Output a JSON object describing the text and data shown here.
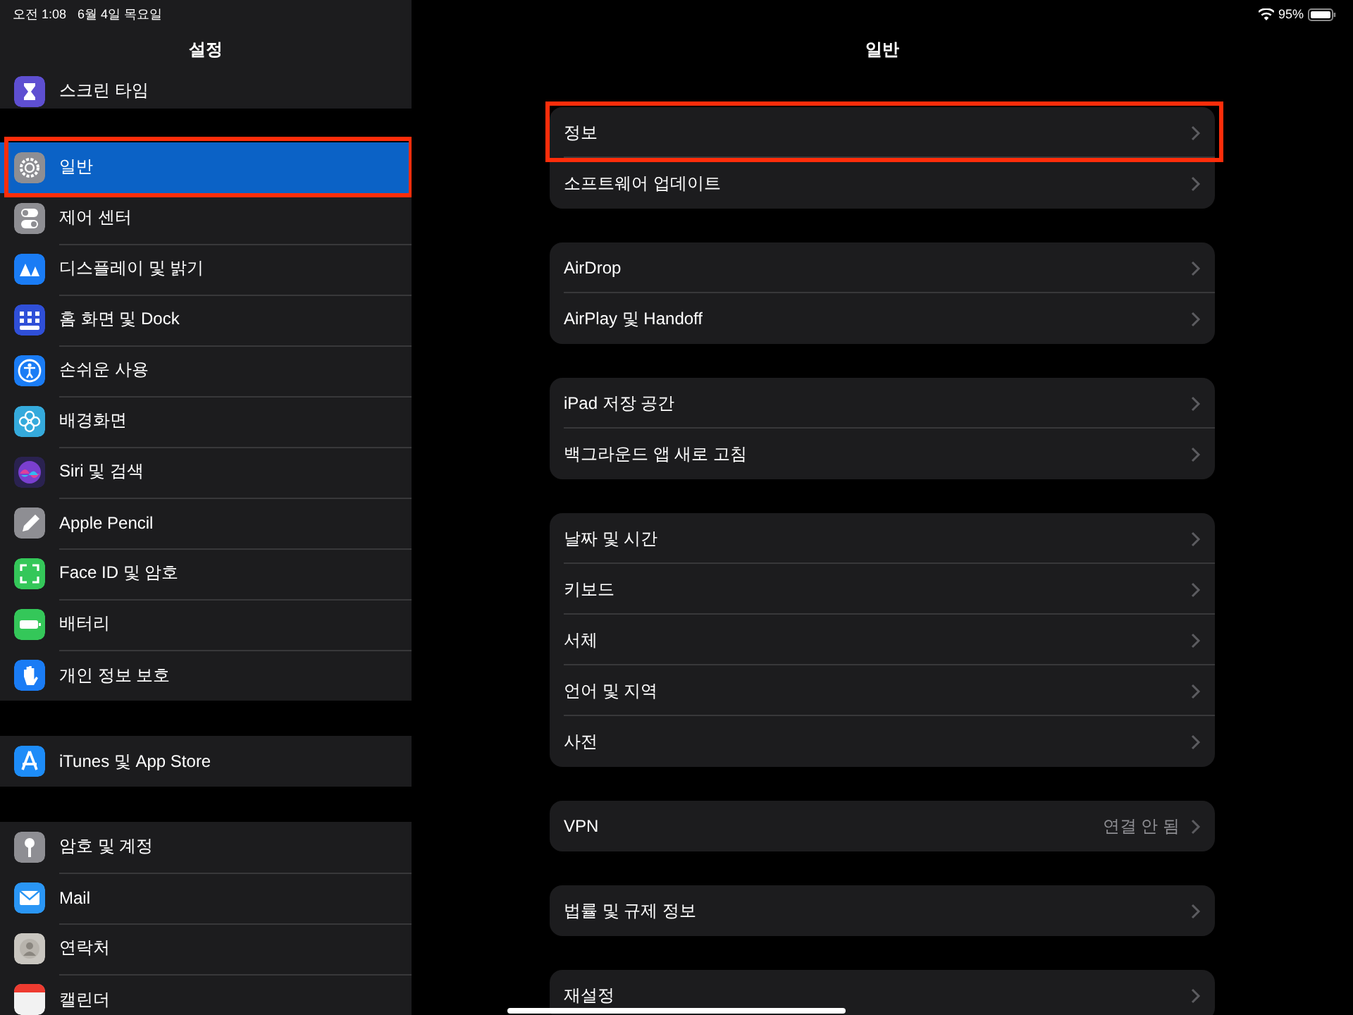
{
  "status_bar": {
    "time": "오전 1:08",
    "date": "6월 4일 목요일",
    "battery": "95%"
  },
  "sidebar": {
    "title": "설정",
    "groups": [
      {
        "items": [
          {
            "label": "스크린 타임",
            "color": "#5e4fd1",
            "selected": false,
            "highlighted": false
          }
        ]
      },
      {
        "items": [
          {
            "label": "일반",
            "color": "#8e8e93",
            "selected": true,
            "highlighted": true
          },
          {
            "label": "제어 센터",
            "color": "#8e8e93",
            "selected": false,
            "highlighted": false
          },
          {
            "label": "디스플레이 및 밝기",
            "color": "#1a7cf5",
            "selected": false,
            "highlighted": false
          },
          {
            "label": "홈 화면 및 Dock",
            "color": "#2f4fd8",
            "selected": false,
            "highlighted": false
          },
          {
            "label": "손쉬운 사용",
            "color": "#1a7cf5",
            "selected": false,
            "highlighted": false
          },
          {
            "label": "배경화면",
            "color": "#35aadc",
            "selected": false,
            "highlighted": false
          },
          {
            "label": "Siri 및 검색",
            "color": "#2a2250",
            "selected": false,
            "highlighted": false
          },
          {
            "label": "Apple Pencil",
            "color": "#8e8e93",
            "selected": false,
            "highlighted": false
          },
          {
            "label": "Face ID 및 암호",
            "color": "#34c759",
            "selected": false,
            "highlighted": false
          },
          {
            "label": "배터리",
            "color": "#34c759",
            "selected": false,
            "highlighted": false
          },
          {
            "label": "개인 정보 보호",
            "color": "#1a7cf5",
            "selected": false,
            "highlighted": false
          }
        ]
      },
      {
        "items": [
          {
            "label": "iTunes 및 App Store",
            "color": "#1d8cf8",
            "selected": false,
            "highlighted": false
          }
        ]
      },
      {
        "items": [
          {
            "label": "암호 및 계정",
            "color": "#8e8e93",
            "selected": false,
            "highlighted": false
          },
          {
            "label": "Mail",
            "color": "#2a96f5",
            "selected": false,
            "highlighted": false
          },
          {
            "label": "연락처",
            "color": "#c9c6c0",
            "selected": false,
            "highlighted": false
          },
          {
            "label": "캘린더",
            "color": "#f2f2f2",
            "selected": false,
            "highlighted": false
          }
        ]
      }
    ]
  },
  "detail": {
    "title": "일반",
    "groups": [
      {
        "rows": [
          {
            "label": "정보",
            "highlighted": true
          },
          {
            "label": "소프트웨어 업데이트",
            "highlighted": false
          }
        ]
      },
      {
        "rows": [
          {
            "label": "AirDrop",
            "highlighted": false
          },
          {
            "label": "AirPlay 및 Handoff",
            "highlighted": false
          }
        ]
      },
      {
        "rows": [
          {
            "label": "iPad 저장 공간",
            "highlighted": false
          },
          {
            "label": "백그라운드 앱 새로 고침",
            "highlighted": false
          }
        ]
      },
      {
        "rows": [
          {
            "label": "날짜 및 시간",
            "highlighted": false
          },
          {
            "label": "키보드",
            "highlighted": false
          },
          {
            "label": "서체",
            "highlighted": false
          },
          {
            "label": "언어 및 지역",
            "highlighted": false
          },
          {
            "label": "사전",
            "highlighted": false
          }
        ]
      },
      {
        "rows": [
          {
            "label": "VPN",
            "value": "연결 안 됨",
            "highlighted": false
          }
        ]
      },
      {
        "rows": [
          {
            "label": "법률 및 규제 정보",
            "highlighted": false
          }
        ]
      },
      {
        "rows": [
          {
            "label": "재설정",
            "highlighted": false
          }
        ]
      }
    ]
  }
}
